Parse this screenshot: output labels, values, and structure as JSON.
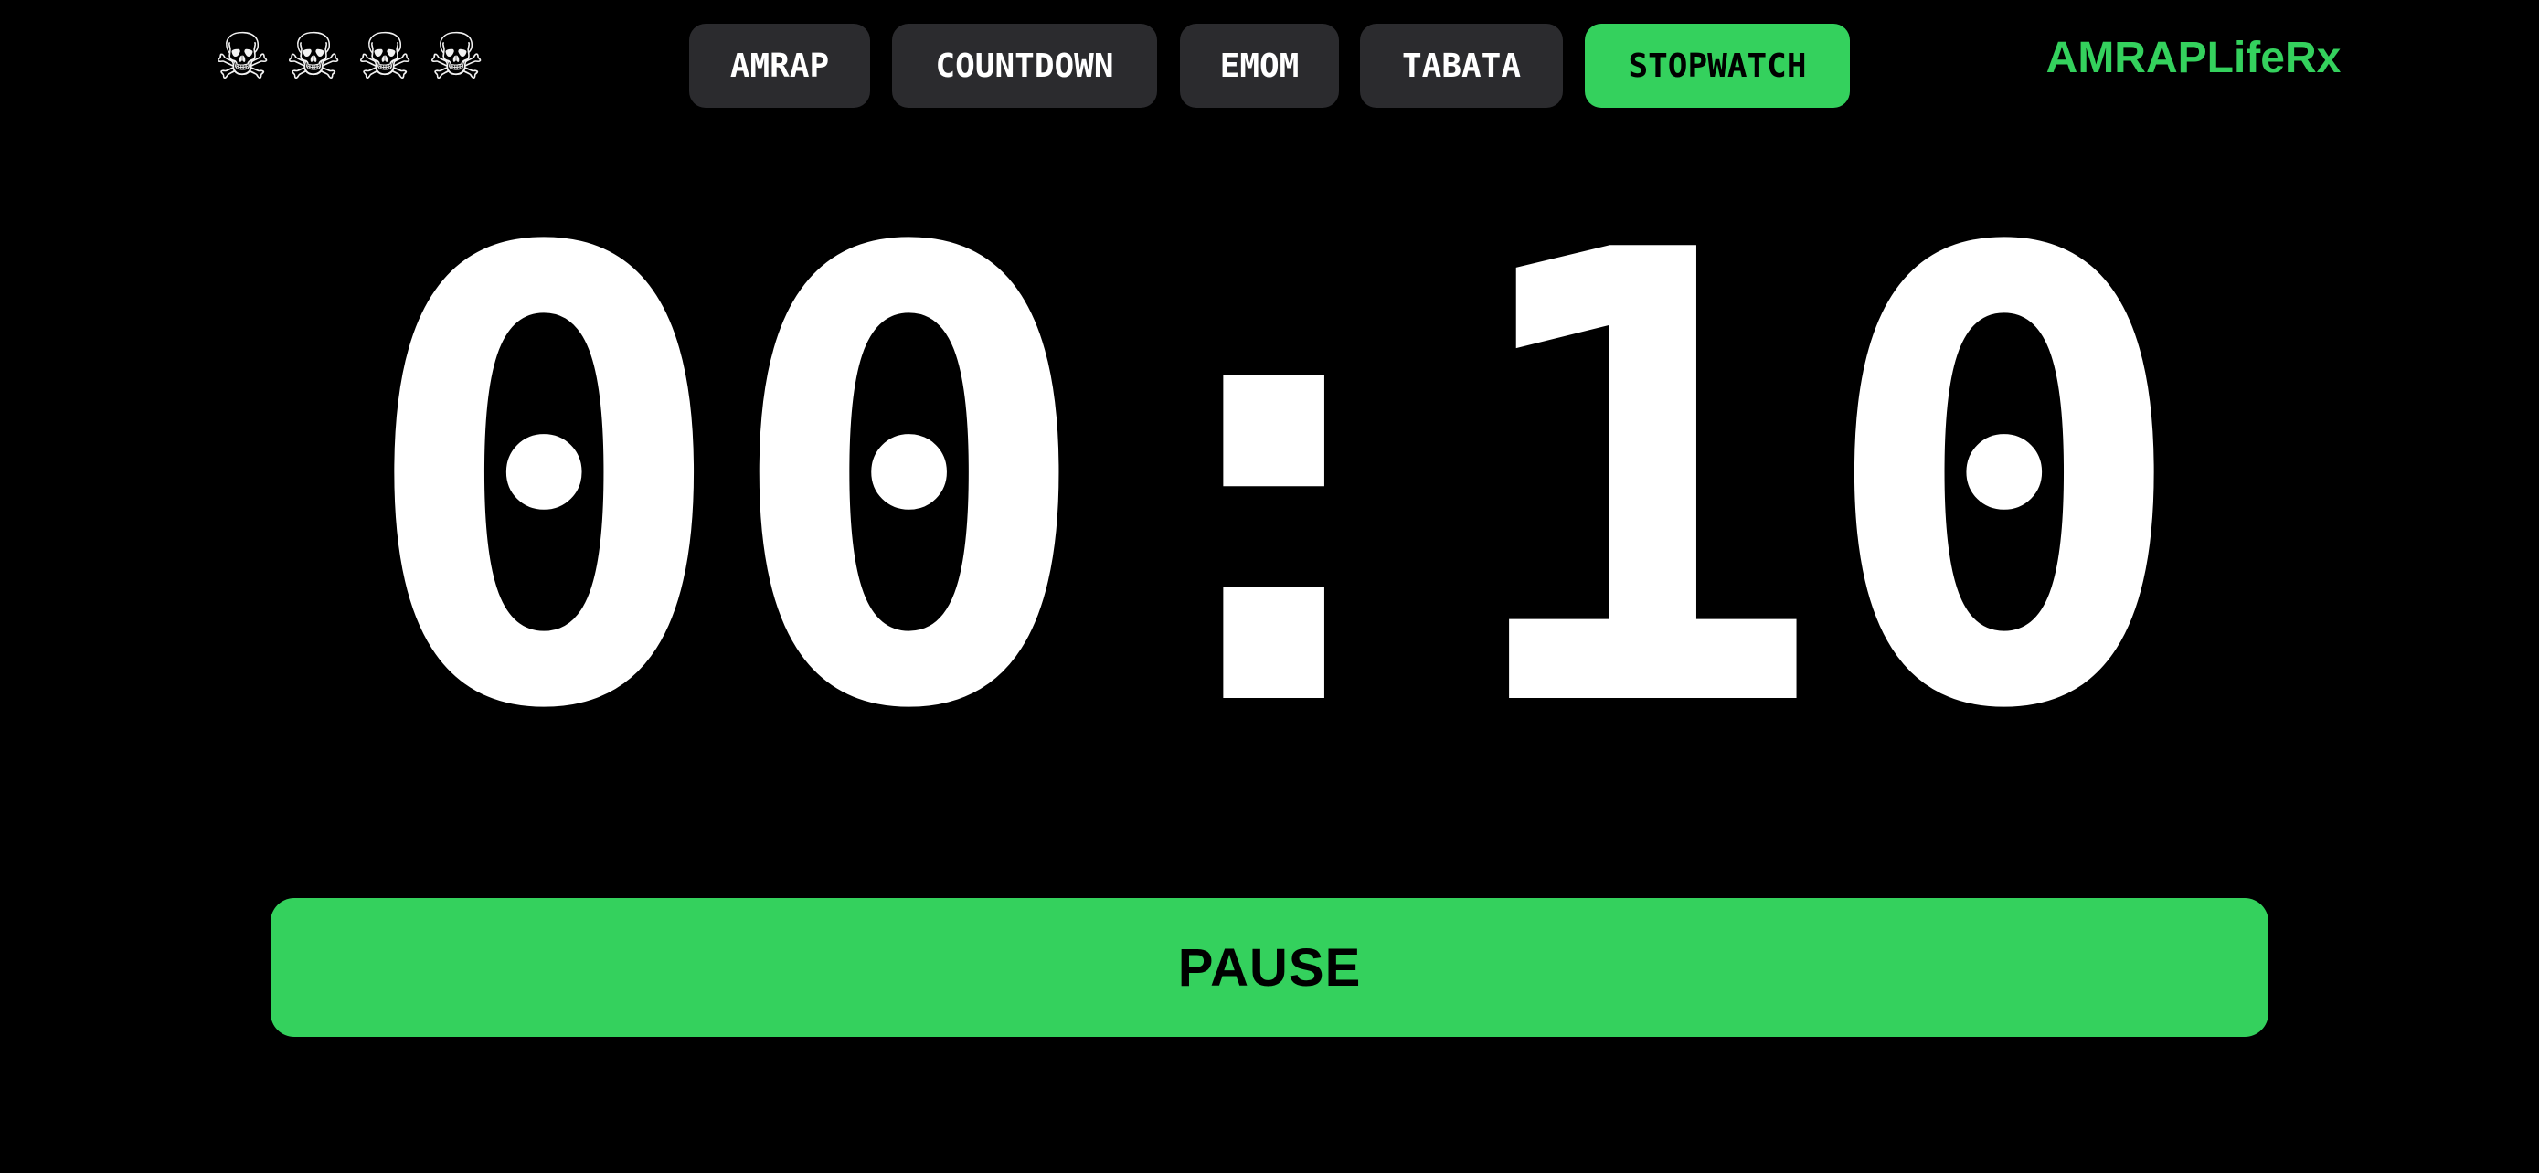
{
  "header": {
    "skulls": [
      "☠",
      "☠",
      "☠",
      "☠"
    ],
    "skull_icon": "skull-and-crossbones-icon",
    "brand": "AMRAPLifeRx"
  },
  "tabs": [
    {
      "label": "AMRAP",
      "active": false
    },
    {
      "label": "COUNTDOWN",
      "active": false
    },
    {
      "label": "EMOM",
      "active": false
    },
    {
      "label": "TABATA",
      "active": false
    },
    {
      "label": "STOPWATCH",
      "active": true
    }
  ],
  "timer": {
    "display": "00:10"
  },
  "controls": {
    "pause_label": "PAUSE"
  },
  "colors": {
    "accent": "#34d15d",
    "tab_bg": "#2b2b2e",
    "background": "#000000",
    "text": "#ffffff"
  }
}
